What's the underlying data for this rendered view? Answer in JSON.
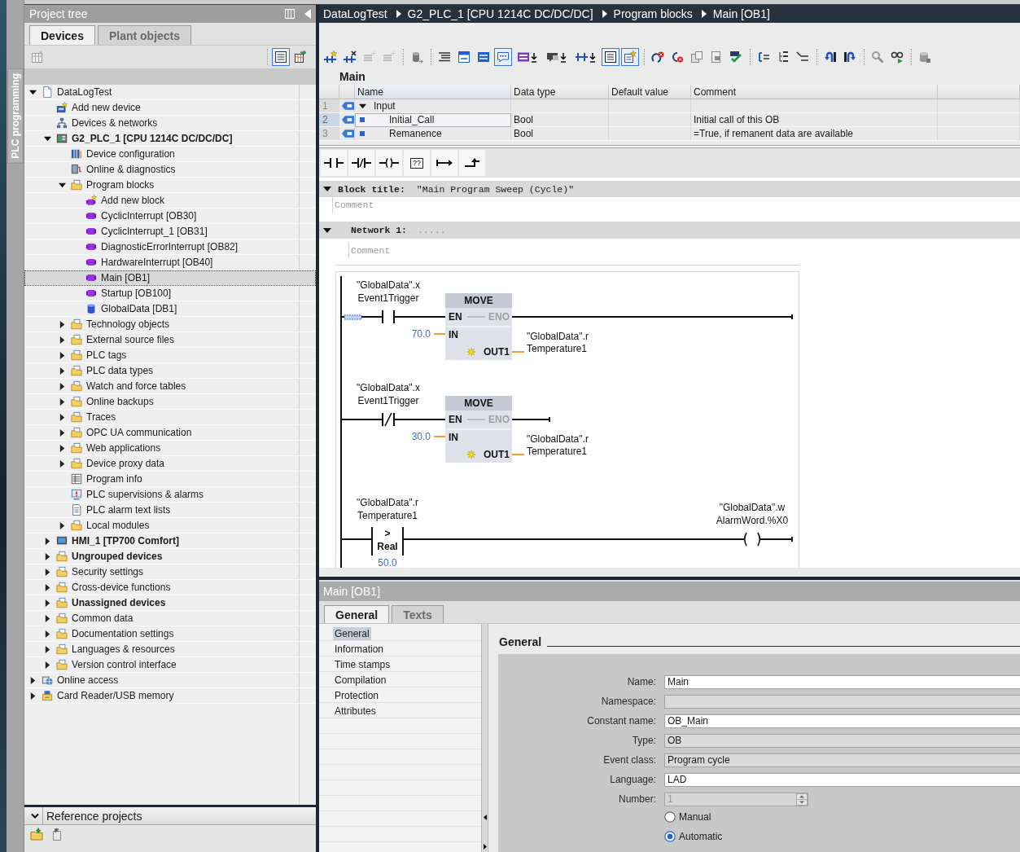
{
  "side_tab": {
    "label": "PLC programming"
  },
  "project_tree": {
    "title": "Project tree",
    "tabs": [
      {
        "label": "Devices",
        "selected": true
      },
      {
        "label": "Plant objects",
        "selected": false
      }
    ],
    "toolbar": {
      "left": [
        {
          "kind": "faded-grid",
          "pressed": false
        }
      ],
      "right": [
        {
          "kind": "list-view",
          "pressed": true
        },
        {
          "kind": "table-arrow",
          "pressed": false
        }
      ]
    },
    "items": [
      {
        "label": "DataLogTest",
        "kind": "document",
        "expanded": true,
        "selected": false,
        "children": [
          {
            "label": "Add new device",
            "kind": "device-star",
            "selected": false
          },
          {
            "label": "Devices & networks",
            "kind": "network",
            "selected": false
          },
          {
            "label": "G2_PLC_1 [CPU 1214C DC/DC/DC]",
            "kind": "plc",
            "bold": true,
            "expanded": true,
            "selected": false,
            "children": [
              {
                "label": "Device configuration",
                "kind": "rack",
                "selected": false
              },
              {
                "label": "Online & diagnostics",
                "kind": "device-wire",
                "selected": false
              },
              {
                "label": "Program blocks",
                "kind": "folder",
                "expanded": true,
                "selected": false,
                "children": [
                  {
                    "label": "Add new block",
                    "kind": "block-star",
                    "selected": false
                  },
                  {
                    "label": "CyclicInterrupt [OB30]",
                    "kind": "block",
                    "selected": false
                  },
                  {
                    "label": "CyclicInterrupt_1 [OB31]",
                    "kind": "block",
                    "selected": false
                  },
                  {
                    "label": "DiagnosticErrorInterrupt [OB82]",
                    "kind": "block",
                    "selected": false
                  },
                  {
                    "label": "HardwareInterrupt [OB40]",
                    "kind": "block",
                    "selected": false
                  },
                  {
                    "label": "Main [OB1]",
                    "kind": "block",
                    "selected": true
                  },
                  {
                    "label": "Startup [OB100]",
                    "kind": "block",
                    "selected": false
                  },
                  {
                    "label": "GlobalData [DB1]",
                    "kind": "cylinder",
                    "selected": false
                  }
                ]
              },
              {
                "label": "Technology objects",
                "kind": "folder",
                "expanded": false,
                "selected": false
              },
              {
                "label": "External source files",
                "kind": "folder",
                "expanded": false,
                "selected": false
              },
              {
                "label": "PLC tags",
                "kind": "folder",
                "expanded": false,
                "selected": false
              },
              {
                "label": "PLC data types",
                "kind": "folder",
                "expanded": false,
                "selected": false
              },
              {
                "label": "Watch and force tables",
                "kind": "folder",
                "expanded": false,
                "selected": false
              },
              {
                "label": "Online backups",
                "kind": "folder",
                "expanded": false,
                "selected": false
              },
              {
                "label": "Traces",
                "kind": "folder",
                "expanded": false,
                "selected": false
              },
              {
                "label": "OPC UA communication",
                "kind": "folder",
                "expanded": false,
                "selected": false
              },
              {
                "label": "Web applications",
                "kind": "folder",
                "expanded": false,
                "selected": false
              },
              {
                "label": "Device proxy data",
                "kind": "folder",
                "expanded": false,
                "selected": false
              },
              {
                "label": "Program info",
                "kind": "table",
                "selected": false
              },
              {
                "label": "PLC supervisions & alarms",
                "kind": "monitor",
                "selected": false
              },
              {
                "label": "PLC alarm text lists",
                "kind": "text-page",
                "selected": false
              },
              {
                "label": "Local modules",
                "kind": "folder",
                "expanded": false,
                "selected": false
              }
            ]
          },
          {
            "label": "HMI_1 [TP700 Comfort]",
            "kind": "screen",
            "bold": true,
            "expanded": false,
            "selected": false
          },
          {
            "label": "Ungrouped devices",
            "kind": "folder",
            "bold": true,
            "expanded": false,
            "selected": false
          },
          {
            "label": "Security settings",
            "kind": "folder",
            "expanded": false,
            "selected": false
          },
          {
            "label": "Cross-device functions",
            "kind": "folder",
            "expanded": false,
            "selected": false
          },
          {
            "label": "Unassigned devices",
            "kind": "folder",
            "bold": true,
            "expanded": false,
            "selected": false
          },
          {
            "label": "Common data",
            "kind": "folder",
            "expanded": false,
            "selected": false
          },
          {
            "label": "Documentation settings",
            "kind": "folder",
            "expanded": false,
            "selected": false
          },
          {
            "label": "Languages & resources",
            "kind": "folder",
            "expanded": false,
            "selected": false
          },
          {
            "label": "Version control interface",
            "kind": "folder",
            "expanded": false,
            "selected": false
          }
        ]
      },
      {
        "label": "Online access",
        "kind": "globe",
        "expanded": false,
        "selected": false
      },
      {
        "label": "Card Reader/USB memory",
        "kind": "card-reader",
        "expanded": false,
        "selected": false
      }
    ]
  },
  "reference_projects": {
    "title": "Reference projects",
    "expanded": true
  },
  "editor": {
    "breadcrumb": [
      "DataLogTest",
      "G2_PLC_1 [CPU 1214C DC/DC/DC]",
      "Program blocks",
      "Main [OB1]"
    ],
    "toolbar": [
      {
        "buttons": [
          {
            "kind": "rung-star",
            "pressed": false
          },
          {
            "kind": "rung-cross",
            "pressed": false
          },
          {
            "kind": "faded-lines",
            "pressed": false
          },
          {
            "kind": "faded-lines",
            "pressed": false
          }
        ]
      },
      {
        "buttons": [
          {
            "kind": "cylinder-arrow",
            "pressed": false
          }
        ]
      },
      {
        "buttons": [
          {
            "kind": "indent-lines",
            "pressed": false
          },
          {
            "kind": "window",
            "pressed": false
          },
          {
            "kind": "panel-lines",
            "pressed": false
          },
          {
            "kind": "speech-bubble",
            "pressed": true
          },
          {
            "kind": "block-down",
            "pressed": false
          },
          {
            "kind": "bubble-down",
            "pressed": false
          },
          {
            "kind": "rung-down",
            "pressed": false
          },
          {
            "kind": "list",
            "pressed": true
          },
          {
            "kind": "star-list",
            "pressed": true
          }
        ]
      },
      {
        "buttons": [
          {
            "kind": "arrow-cross",
            "pressed": false
          },
          {
            "kind": "arc-cross",
            "pressed": false
          },
          {
            "kind": "pages",
            "pressed": false
          },
          {
            "kind": "page",
            "pressed": false
          },
          {
            "kind": "check",
            "pressed": false
          }
        ]
      },
      {
        "buttons": [
          {
            "kind": "bracket-lines",
            "pressed": false
          },
          {
            "kind": "tree-lines",
            "pressed": false
          },
          {
            "kind": "branch-lines",
            "pressed": false
          }
        ]
      },
      {
        "buttons": [
          {
            "kind": "curved-left",
            "pressed": false
          },
          {
            "kind": "curved-right",
            "pressed": false
          }
        ]
      },
      {
        "buttons": [
          {
            "kind": "magnifier",
            "pressed": false
          },
          {
            "kind": "glasses",
            "pressed": false
          }
        ]
      },
      {
        "buttons": [
          {
            "kind": "cylinder-lock",
            "pressed": false
          }
        ]
      }
    ],
    "interface": {
      "title": "Main",
      "columns": [
        "Name",
        "Data type",
        "Default value",
        "Comment"
      ],
      "rows": [
        {
          "kind": "section",
          "number": "1",
          "name": "Input",
          "expanded": true,
          "selected": false
        },
        {
          "kind": "parameter",
          "number": "2",
          "name": "Initial_Call",
          "data_type": "Bool",
          "comment": "Initial call of this OB",
          "selected": true
        },
        {
          "kind": "parameter",
          "number": "3",
          "name": "Remanence",
          "data_type": "Bool",
          "comment": "=True, if remanent data are available",
          "selected": false
        }
      ]
    },
    "lad_toolbar": [
      {
        "kind": "contact"
      },
      {
        "kind": "negated-contact"
      },
      {
        "kind": "coil"
      },
      {
        "kind": "box",
        "label": "??"
      },
      {
        "kind": "open-branch"
      },
      {
        "kind": "close-branch"
      }
    ],
    "block_title": {
      "label": "Block title:",
      "value": "\"Main Program Sweep (Cycle)\"",
      "expanded": true,
      "comment": {
        "placeholder": "Comment"
      }
    },
    "networks": [
      {
        "label": "Network 1:",
        "title": ".....",
        "expanded": true,
        "comment": {
          "placeholder": "Comment"
        },
        "rungs": [
          {
            "kind": "move",
            "selected": true,
            "contact": {
              "kind": "normally-open",
              "operand": [
                "\"GlobalData\".x",
                "Event1Trigger"
              ]
            },
            "box": {
              "title": "MOVE",
              "enable_in": "EN",
              "enable_out": "ENO",
              "input": "IN",
              "input_value": "70.0",
              "output": "OUT1",
              "output_operand": [
                "\"GlobalData\".r",
                "Temperature1"
              ]
            },
            "eno_connected": true
          },
          {
            "kind": "move",
            "selected": false,
            "contact": {
              "kind": "normally-closed",
              "operand": [
                "\"GlobalData\".x",
                "Event1Trigger"
              ]
            },
            "box": {
              "title": "MOVE",
              "enable_in": "EN",
              "enable_out": "ENO",
              "input": "IN",
              "input_value": "30.0",
              "output": "OUT1",
              "output_operand": [
                "\"GlobalData\".r",
                "Temperature1"
              ]
            },
            "eno_connected": false
          },
          {
            "kind": "compare",
            "selected": false,
            "comparator": {
              "operator": ">",
              "type": "Real",
              "operand": [
                "\"GlobalData\".r",
                "Temperature1"
              ],
              "value": "50.0"
            },
            "coil": {
              "operand": [
                "\"GlobalData\".w",
                "AlarmWord.%X0"
              ]
            }
          }
        ]
      }
    ]
  },
  "properties": {
    "title": "Main [OB1]",
    "tabs": [
      {
        "label": "General",
        "selected": true
      },
      {
        "label": "Texts",
        "selected": false
      }
    ],
    "nav": [
      {
        "label": "General",
        "selected": true
      },
      {
        "label": "Information",
        "selected": false
      },
      {
        "label": "Time stamps",
        "selected": false
      },
      {
        "label": "Compilation",
        "selected": false
      },
      {
        "label": "Protection",
        "selected": false
      },
      {
        "label": "Attributes",
        "selected": false
      }
    ],
    "section": "General",
    "fields": [
      {
        "kind": "text",
        "label": "Name:",
        "value": "Main",
        "readonly": false
      },
      {
        "kind": "text",
        "label": "Namespace:",
        "readonly": true
      },
      {
        "kind": "text",
        "label": "Constant name:",
        "value": "OB_Main",
        "readonly": false
      },
      {
        "kind": "text",
        "label": "Type:",
        "value": "OB",
        "readonly": true
      },
      {
        "kind": "text",
        "label": "Event class:",
        "value": "Program cycle",
        "readonly": true
      },
      {
        "kind": "text",
        "label": "Language:",
        "value": "LAD",
        "readonly": false
      },
      {
        "kind": "spinner",
        "label": "Number:",
        "value": "1",
        "disabled": true
      }
    ],
    "numbering": [
      {
        "label": "Manual",
        "selected": false
      },
      {
        "label": "Automatic",
        "selected": true
      }
    ]
  }
}
